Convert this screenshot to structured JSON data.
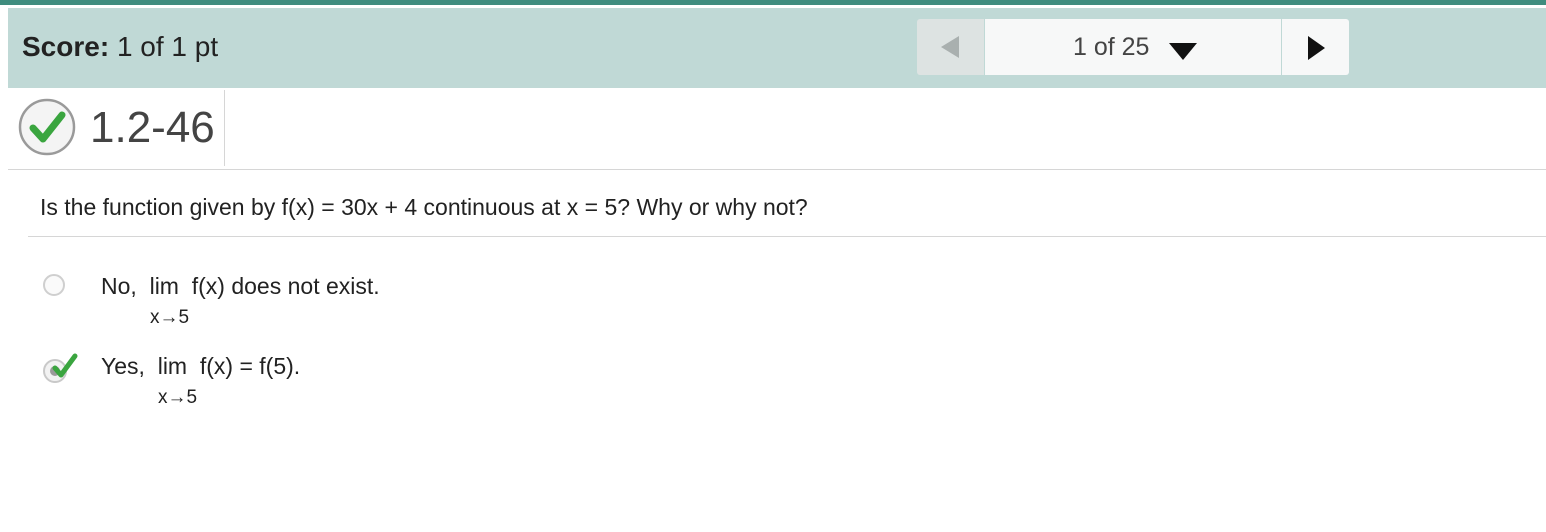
{
  "score": {
    "label": "Score:",
    "value": "1 of 1 pt"
  },
  "navigation": {
    "position": "1 of 25",
    "prev_icon": "triangle-left-icon",
    "next_icon": "triangle-right-icon",
    "dropdown_icon": "caret-down-icon"
  },
  "question_header": {
    "status_icon": "check-circle-icon",
    "id": "1.2-46"
  },
  "question": {
    "text": "Is the function given by f(x) = 30x + 4 continuous at x = 5? Why or why not?"
  },
  "options": [
    {
      "selected": false,
      "prefix": "No,",
      "lim": "lim",
      "rest": "f(x) does not exist.",
      "subscript": "x→5"
    },
    {
      "selected": true,
      "correct": true,
      "prefix": "Yes,",
      "lim": "lim",
      "rest": "f(x) = f(5).",
      "subscript": "x→5"
    }
  ],
  "colors": {
    "top_stripe": "#3f8c7e",
    "score_bar": "#c0d9d6",
    "correct_green": "#3aa53f"
  }
}
